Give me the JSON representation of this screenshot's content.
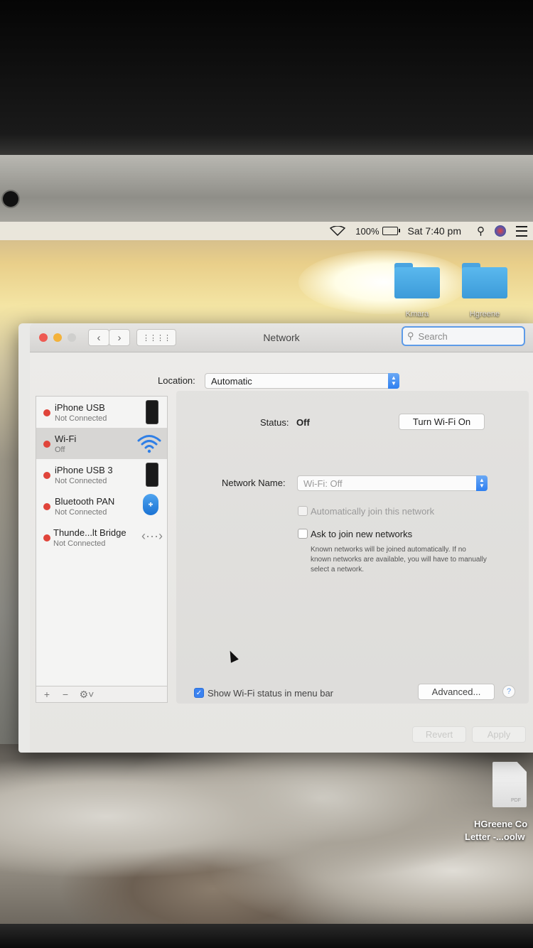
{
  "menubar": {
    "battery": "100%",
    "clock": "Sat 7:40 pm"
  },
  "desktop": {
    "folders": [
      {
        "label": "Kmara"
      },
      {
        "label": "Hgreene"
      }
    ],
    "file": {
      "badge": "PDF",
      "line1": "HGreene Co",
      "line2": "Letter -...oolw"
    }
  },
  "window": {
    "title": "Network",
    "search_placeholder": "Search",
    "location_label": "Location:",
    "location_value": "Automatic",
    "services": [
      {
        "name": "iPhone USB",
        "status": "Not Connected",
        "icon": "iphone-icon",
        "selected": false
      },
      {
        "name": "Wi-Fi",
        "status": "Off",
        "icon": "wifi-icon",
        "selected": true
      },
      {
        "name": "iPhone USB 3",
        "status": "Not Connected",
        "icon": "iphone-icon",
        "selected": false
      },
      {
        "name": "Bluetooth PAN",
        "status": "Not Connected",
        "icon": "bluetooth-icon",
        "selected": false
      },
      {
        "name": "Thunde...lt Bridge",
        "status": "Not Connected",
        "icon": "thunderbolt-bridge-icon",
        "selected": false
      }
    ],
    "status_label": "Status:",
    "status_value": "Off",
    "turn_on_button": "Turn Wi-Fi On",
    "network_name_label": "Network Name:",
    "network_name_value": "Wi-Fi: Off",
    "auto_join_label": "Automatically join this network",
    "auto_join_checked": false,
    "ask_join_label": "Ask to join new networks",
    "ask_join_checked": false,
    "ask_join_note": "Known networks will be joined automatically. If no known networks are available, you will have to manually select a network.",
    "show_status_label": "Show Wi-Fi status in menu bar",
    "show_status_checked": true,
    "advanced_button": "Advanced...",
    "help_button": "?",
    "revert_button": "Revert",
    "apply_button": "Apply",
    "status_dot_color": "#e0443a",
    "accent_color": "#3b82f0"
  }
}
